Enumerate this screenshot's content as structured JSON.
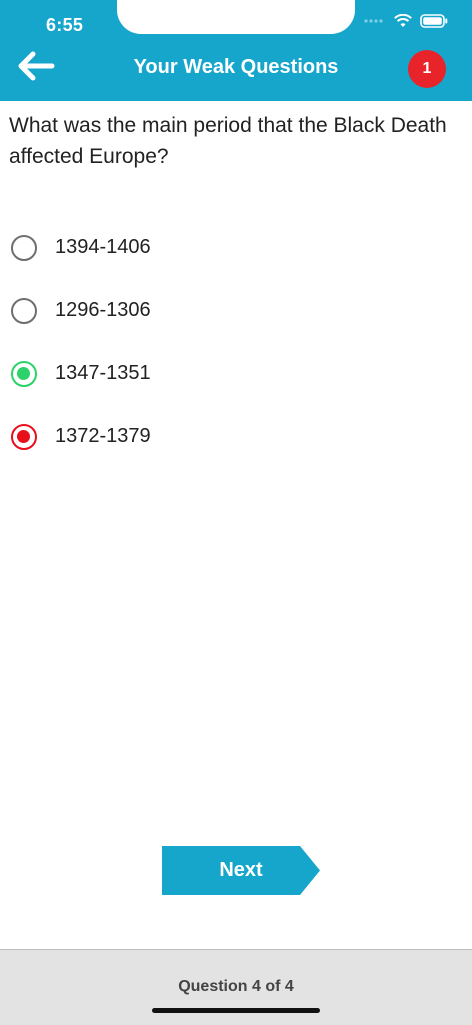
{
  "status_bar": {
    "time": "6:55"
  },
  "header": {
    "back_icon": "arrow-left-icon",
    "title": "Your Weak Questions",
    "badge_count": "1"
  },
  "question": {
    "text": "What was the main period that the Black Death affected Europe?"
  },
  "options": [
    {
      "label": "1394-1406",
      "state": "unselected"
    },
    {
      "label": "1296-1306",
      "state": "unselected"
    },
    {
      "label": "1347-1351",
      "state": "correct"
    },
    {
      "label": "1372-1379",
      "state": "wrong"
    }
  ],
  "next_button": {
    "label": "Next"
  },
  "footer": {
    "progress_text": "Question 4 of 4"
  },
  "colors": {
    "header": "#16a6cc",
    "badge": "#e8232a",
    "correct": "#2dd26a",
    "wrong": "#e8101a",
    "footer": "#e3e3e3"
  }
}
